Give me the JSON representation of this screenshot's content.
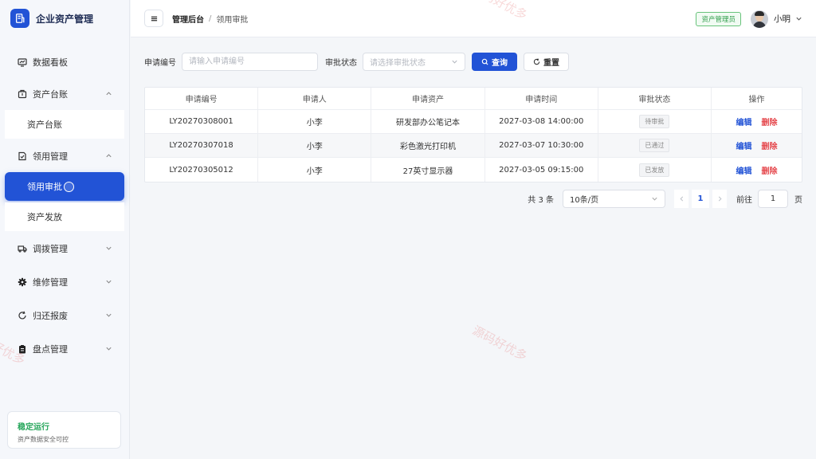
{
  "app": {
    "title": "企业资产管理"
  },
  "sidebar": {
    "items": [
      {
        "label": "数据看板",
        "icon": "dashboard-icon"
      },
      {
        "label": "资产台账",
        "icon": "ledger-icon",
        "expanded": true,
        "children": [
          {
            "label": "资产台账"
          }
        ]
      },
      {
        "label": "领用管理",
        "icon": "requisition-icon",
        "expanded": true,
        "children": [
          {
            "label": "领用审批",
            "active": true
          },
          {
            "label": "资产发放"
          }
        ]
      },
      {
        "label": "调拨管理",
        "icon": "truck-icon"
      },
      {
        "label": "维修管理",
        "icon": "gear-icon"
      },
      {
        "label": "归还报废",
        "icon": "refresh-icon"
      },
      {
        "label": "盘点管理",
        "icon": "clipboard-icon"
      }
    ],
    "status": {
      "title": "稳定运行",
      "subtitle": "资产数据安全可控"
    }
  },
  "header": {
    "breadcrumb": {
      "root": "管理后台",
      "separator": "/",
      "current": "领用审批"
    },
    "role": "资产管理员",
    "user": "小明"
  },
  "filters": {
    "code_label": "申请编号",
    "code_placeholder": "请输入申请编号",
    "status_label": "审批状态",
    "status_placeholder": "请选择审批状态",
    "search_label": "查询",
    "reset_label": "重置"
  },
  "table": {
    "columns": [
      "申请编号",
      "申请人",
      "申请资产",
      "申请时间",
      "审批状态",
      "操作"
    ],
    "rows": [
      {
        "code": "LY20270308001",
        "applicant": "小李",
        "asset": "研发部办公笔记本",
        "time": "2027-03-08 14:00:00",
        "status": "待审批"
      },
      {
        "code": "LY20270307018",
        "applicant": "小李",
        "asset": "彩色激光打印机",
        "time": "2027-03-07 10:30:00",
        "status": "已通过"
      },
      {
        "code": "LY20270305012",
        "applicant": "小李",
        "asset": "27英寸显示器",
        "time": "2027-03-05 09:15:00",
        "status": "已发放"
      }
    ],
    "edit_label": "编辑",
    "delete_label": "删除"
  },
  "pagination": {
    "total": "共 3 条",
    "page_size": "10条/页",
    "current_page": "1",
    "goto_label": "前往",
    "goto_value": "1",
    "unit": "页"
  },
  "colors": {
    "primary": "#2253d6",
    "danger": "#e5484d",
    "success": "#2f9d4a"
  },
  "watermark": "源码好优多"
}
